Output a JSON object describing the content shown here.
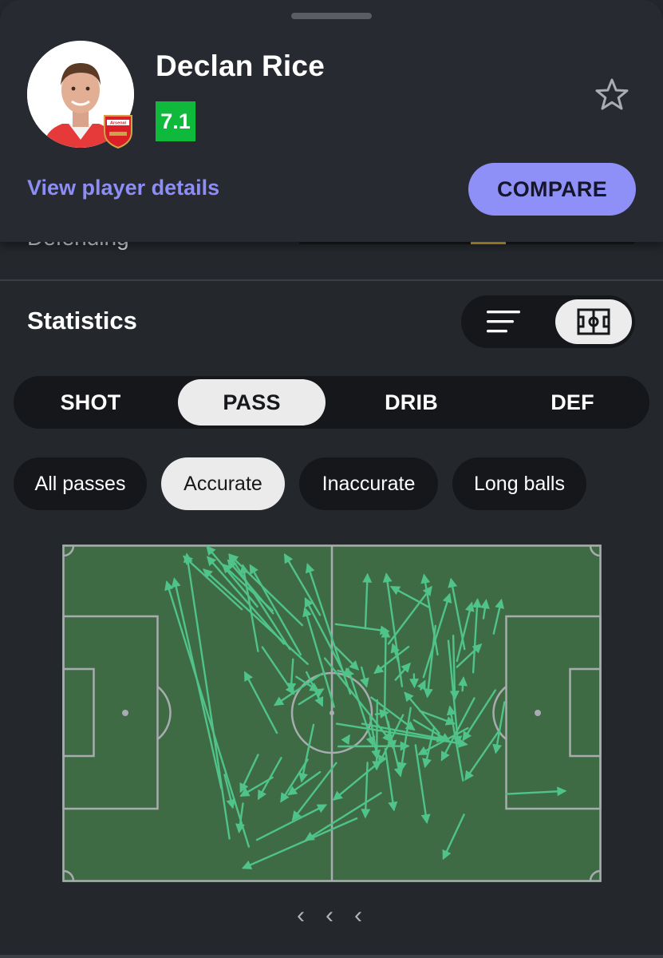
{
  "player": {
    "name": "Declan Rice",
    "rating": "7.1",
    "club_badge_text": "Arsenal",
    "details_link": "View player details",
    "compare_label": "COMPARE",
    "favorite_icon": "star-outline-icon"
  },
  "partially_hidden_row": {
    "label": "Defending"
  },
  "statistics": {
    "title": "Statistics",
    "view_toggle": {
      "list_icon": "list-lines-icon",
      "pitch_icon": "pitch-icon",
      "selected": "pitch"
    }
  },
  "tabs": [
    {
      "label": "SHOT",
      "active": false
    },
    {
      "label": "PASS",
      "active": true
    },
    {
      "label": "DRIB",
      "active": false
    },
    {
      "label": "DEF",
      "active": false
    }
  ],
  "filters": [
    {
      "label": "All passes",
      "active": false
    },
    {
      "label": "Accurate",
      "active": true
    },
    {
      "label": "Inaccurate",
      "active": false
    },
    {
      "label": "Long balls",
      "active": false
    }
  ],
  "pass_map": {
    "type": "scatter",
    "pitch": {
      "length": 100,
      "width": 100
    },
    "pass_color": "#4fc38a",
    "pitch_color": "#3f6b44",
    "attacking_direction": "right",
    "passes": [
      [
        29.5,
        72.2,
        20.8,
        10.3
      ],
      [
        31.0,
        87.1,
        23.1,
        3.0
      ],
      [
        34.6,
        89.5,
        19.4,
        11.2
      ],
      [
        33.3,
        19.2,
        22.6,
        3.6
      ],
      [
        39.1,
        20.4,
        30.8,
        4.8
      ],
      [
        36.2,
        18.4,
        26.9,
        0.7
      ],
      [
        41.1,
        29.4,
        27.0,
        3.8
      ],
      [
        39.0,
        19.6,
        29.8,
        6.0
      ],
      [
        36.3,
        31.6,
        33.5,
        6.3
      ],
      [
        44.5,
        23.9,
        31.1,
        3.1
      ],
      [
        42.2,
        31.0,
        31.0,
        3.1
      ],
      [
        44.2,
        32.6,
        34.9,
        6.3
      ],
      [
        45.5,
        35.4,
        26.3,
        7.5
      ],
      [
        47.8,
        20.9,
        41.3,
        3.1
      ],
      [
        53.4,
        44.2,
        45.5,
        6.0
      ],
      [
        52.5,
        38.9,
        45.1,
        16.1
      ],
      [
        56.2,
        24.9,
        56.6,
        9.0
      ],
      [
        50.4,
        48.1,
        45.0,
        19.0
      ],
      [
        59.8,
        49.1,
        60.0,
        25.3
      ],
      [
        63.0,
        42.0,
        60.1,
        8.9
      ],
      [
        60.5,
        29.4,
        68.4,
        12.7
      ],
      [
        67.0,
        39.3,
        71.8,
        14.9
      ],
      [
        69.6,
        32.6,
        67.1,
        9.2
      ],
      [
        73.2,
        34.5,
        75.9,
        17.5
      ],
      [
        76.2,
        37.9,
        77.0,
        16.4
      ],
      [
        78.1,
        21.9,
        78.6,
        16.7
      ],
      [
        74.6,
        31.0,
        72.1,
        10.4
      ],
      [
        80.0,
        26.4,
        81.4,
        16.6
      ],
      [
        67.9,
        18.5,
        61.1,
        12.6
      ],
      [
        50.7,
        23.6,
        60.4,
        25.7
      ],
      [
        39.8,
        55.8,
        33.9,
        38.0
      ],
      [
        37.1,
        30.4,
        42.9,
        44.1
      ],
      [
        43.4,
        39.2,
        47.4,
        43.3
      ],
      [
        42.8,
        34.0,
        42.4,
        43.3
      ],
      [
        48.2,
        38.2,
        39.5,
        47.5
      ],
      [
        39.0,
        69.0,
        33.2,
        74.4
      ],
      [
        36.3,
        62.3,
        33.1,
        73.1
      ],
      [
        33.5,
        76.7,
        32.8,
        85.0
      ],
      [
        40.6,
        63.2,
        36.4,
        75.2
      ],
      [
        45.5,
        63.7,
        40.6,
        76.0
      ],
      [
        47.8,
        67.4,
        42.0,
        74.0
      ],
      [
        30.1,
        68.2,
        31.6,
        77.8
      ],
      [
        36.1,
        87.5,
        48.8,
        77.2
      ],
      [
        48.7,
        33.7,
        60.9,
        58.2
      ],
      [
        60.4,
        52.4,
        61.4,
        60.3
      ],
      [
        69.9,
        55.9,
        63.6,
        44.0
      ],
      [
        59.7,
        48.7,
        62.7,
        68.4
      ],
      [
        63.2,
        50.5,
        58.8,
        64.8
      ],
      [
        55.6,
        53.1,
        70.9,
        57.7
      ],
      [
        50.9,
        53.1,
        74.9,
        59.2
      ],
      [
        51.2,
        59.8,
        64.1,
        59.7
      ],
      [
        53.0,
        36.8,
        57.6,
        59.3
      ],
      [
        58.4,
        46.1,
        58.3,
        66.4
      ],
      [
        64.6,
        48.4,
        62.8,
        66.8
      ],
      [
        80.3,
        43.2,
        74.4,
        57.8
      ],
      [
        71.6,
        28.5,
        73.4,
        59.0
      ],
      [
        65.2,
        52.0,
        71.7,
        58.2
      ],
      [
        74.3,
        69.9,
        71.9,
        48.2
      ],
      [
        80.8,
        55.6,
        74.8,
        69.5
      ],
      [
        82.0,
        46.7,
        80.4,
        61.5
      ],
      [
        76.4,
        45.5,
        70.4,
        63.7
      ],
      [
        82.3,
        73.9,
        93.2,
        73.0
      ],
      [
        65.5,
        59.4,
        67.6,
        82.2
      ],
      [
        59.9,
        60.5,
        61.5,
        78.5
      ],
      [
        57.1,
        51.1,
        58.4,
        63.2
      ],
      [
        46.6,
        53.4,
        44.4,
        70.0
      ],
      [
        58.6,
        64.7,
        50.4,
        75.5
      ],
      [
        68.9,
        54.3,
        67.3,
        65.7
      ],
      [
        56.6,
        64.6,
        56.2,
        80.6
      ],
      [
        75.2,
        54.4,
        66.2,
        62.1
      ],
      [
        59.1,
        73.6,
        45.2,
        87.5
      ],
      [
        54.6,
        81.1,
        33.6,
        95.8
      ],
      [
        50.8,
        64.7,
        42.8,
        81.4
      ],
      [
        52.5,
        58.4,
        53.2,
        56.7
      ],
      [
        58.1,
        50.3,
        60.3,
        49.8
      ],
      [
        74.2,
        43.3,
        74.4,
        39.6
      ],
      [
        66.3,
        49.3,
        72.6,
        53.0
      ],
      [
        57.3,
        45.3,
        65.2,
        54.8
      ],
      [
        62.3,
        34.6,
        61.3,
        29.7
      ],
      [
        65.2,
        38.4,
        65.3,
        42.0
      ],
      [
        61.8,
        40.1,
        64.4,
        35.4
      ],
      [
        64.2,
        30.3,
        58.0,
        38.0
      ],
      [
        50.7,
        30.4,
        54.8,
        36.9
      ],
      [
        74.5,
        80.0,
        70.7,
        92.9
      ],
      [
        43.9,
        47.3,
        48.3,
        42.9
      ],
      [
        51.1,
        37.4,
        53.8,
        38.3
      ],
      [
        55.5,
        36.4,
        56.4,
        41.9
      ],
      [
        66.5,
        42.9,
        67.2,
        40.6
      ],
      [
        45.3,
        37.8,
        48.2,
        47.6
      ],
      [
        69.2,
        24.1,
        67.7,
        45.0
      ],
      [
        72.5,
        27.0,
        72.8,
        45.6
      ],
      [
        73.2,
        36.3,
        77.6,
        29.7
      ]
    ]
  },
  "pager": [
    "‹",
    "‹",
    "‹"
  ]
}
